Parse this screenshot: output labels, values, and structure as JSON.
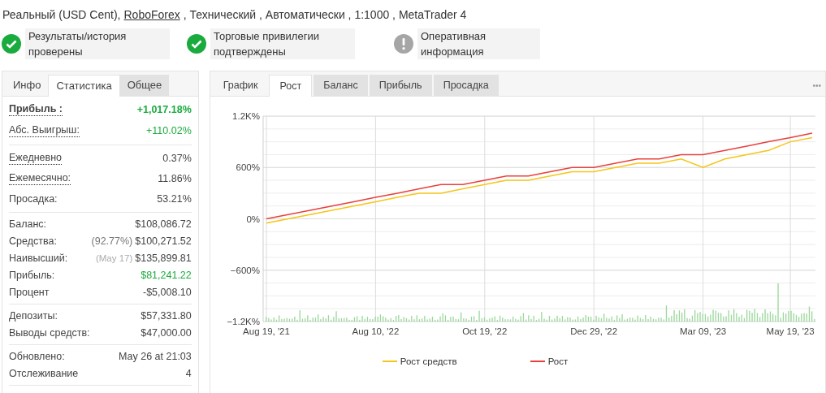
{
  "account": {
    "type": "Реальный (USD Cent),",
    "broker": "RoboForex",
    "details": ", Технический , Автоматически , 1:1000 , MetaTrader 4"
  },
  "badges": [
    {
      "kind": "check",
      "text": "Результаты/история проверены"
    },
    {
      "kind": "check",
      "text": "Торговые привилегии подтверждены"
    },
    {
      "kind": "info",
      "text": "Оперативная информация"
    }
  ],
  "stats_tabs": [
    {
      "label": "Инфо",
      "selected": false
    },
    {
      "label": "Статистика",
      "selected": true
    },
    {
      "label": "Общее",
      "selected": false
    }
  ],
  "stats": [
    [
      {
        "label": "Прибыль :",
        "value": "+1,017.18%",
        "bold": true,
        "underlined": true,
        "green": true
      },
      {
        "label": "Абс. Выигрыш:",
        "value": "+110.02%",
        "bold": false,
        "underlined": true,
        "green": true
      }
    ],
    [
      {
        "label": "Ежедневно",
        "value": "0.37%",
        "bold": false,
        "underlined": true,
        "green": false
      },
      {
        "label": "Ежемесячно:",
        "value": "11.86%",
        "bold": false,
        "underlined": true,
        "green": false
      },
      {
        "label": "Просадка:",
        "value": "53.21%",
        "bold": false,
        "underlined": false,
        "green": false
      }
    ],
    [
      {
        "label": "Баланс:",
        "value": "$108,086.72",
        "bold": false,
        "underlined": false,
        "green": false
      },
      {
        "label": "Средства:",
        "note": "(92.77%)",
        "value": "$100,271.52",
        "bold": false,
        "underlined": false,
        "green": false
      },
      {
        "label": "Наивысший:",
        "note": "(May 17)",
        "value": "$135,899.81",
        "bold": false,
        "underlined": false,
        "green": false
      },
      {
        "label": "Прибыль:",
        "value": "$81,241.22",
        "bold": false,
        "underlined": false,
        "green": true
      },
      {
        "label": "Процент",
        "value": "-$5,008.10",
        "bold": false,
        "underlined": false,
        "green": false
      }
    ],
    [
      {
        "label": "Депозиты:",
        "value": "$57,331.80",
        "bold": false,
        "underlined": false,
        "green": false
      },
      {
        "label": "Выводы средств:",
        "value": "$47,000.00",
        "bold": false,
        "underlined": false,
        "green": false
      }
    ],
    [
      {
        "label": "Обновлено:",
        "value": "May 26 at 21:03",
        "bold": false,
        "underlined": false,
        "green": false
      },
      {
        "label": "Отслеживание",
        "value": "4",
        "bold": false,
        "underlined": false,
        "green": false
      }
    ]
  ],
  "chart_tabs": [
    {
      "label": "График",
      "selected": false
    },
    {
      "label": "Рост",
      "selected": true
    },
    {
      "label": "Баланс",
      "selected": false
    },
    {
      "label": "Прибыль",
      "selected": false
    },
    {
      "label": "Просадка",
      "selected": false
    }
  ],
  "more_button": "•••",
  "chart_data": {
    "type": "line",
    "categories": [
      "Aug 19, '21",
      null,
      null,
      null,
      null,
      "Aug 10, '22",
      null,
      null,
      null,
      null,
      "Oct 19, '22",
      null,
      null,
      null,
      null,
      "Dec 29, '22",
      null,
      null,
      null,
      null,
      "Mar 09, '23",
      null,
      null,
      null,
      "May 19, '23",
      null
    ],
    "ylim": [
      -1200,
      1200
    ],
    "grid": true,
    "legend": "bottom",
    "yticks": [
      {
        "value": 1200,
        "label": "1.2K%"
      },
      {
        "value": 600,
        "label": "600%"
      },
      {
        "value": 0,
        "label": "0%"
      },
      {
        "value": -600,
        "label": "−600%"
      },
      {
        "value": -1200,
        "label": "−1.2K%"
      }
    ],
    "series": [
      {
        "name": "Рост средств",
        "color": "#f5c518",
        "values": [
          -50,
          0,
          50,
          100,
          150,
          200,
          250,
          300,
          300,
          350,
          400,
          450,
          450,
          500,
          550,
          550,
          600,
          650,
          650,
          700,
          600,
          700,
          750,
          800,
          900,
          950
        ]
      },
      {
        "name": "Рост",
        "color": "#e8413c",
        "values": [
          0,
          50,
          100,
          150,
          200,
          250,
          300,
          350,
          400,
          400,
          450,
          500,
          500,
          550,
          600,
          600,
          650,
          700,
          700,
          750,
          750,
          800,
          850,
          900,
          950,
          1000
        ]
      }
    ]
  }
}
